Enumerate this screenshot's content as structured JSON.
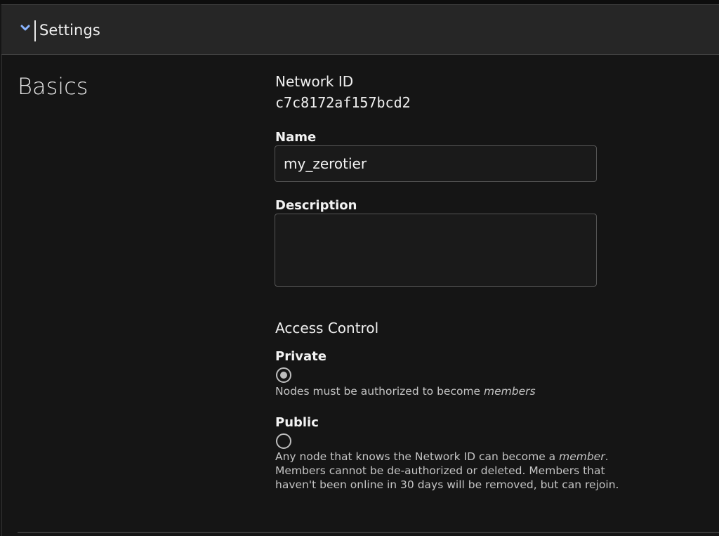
{
  "header": {
    "title": "Settings",
    "collapse_icon": "chevron-down-icon",
    "accent_color": "#8ab4ff"
  },
  "section": {
    "title": "Basics"
  },
  "network_id": {
    "label": "Network ID",
    "value": "c7c8172af157bcd2"
  },
  "name": {
    "label": "Name",
    "value": "my_zerotier"
  },
  "description": {
    "label": "Description",
    "value": ""
  },
  "access_control": {
    "title": "Access Control",
    "options": [
      {
        "label": "Private",
        "selected": true,
        "help_prefix": "Nodes must be authorized to become ",
        "help_em": "members",
        "help_suffix": ""
      },
      {
        "label": "Public",
        "selected": false,
        "help_prefix": "Any node that knows the Network ID can become a ",
        "help_em": "member",
        "help_suffix": ". Members cannot be de-authorized or deleted. Members that haven't been online in 30 days will be removed, but can rejoin."
      }
    ]
  }
}
